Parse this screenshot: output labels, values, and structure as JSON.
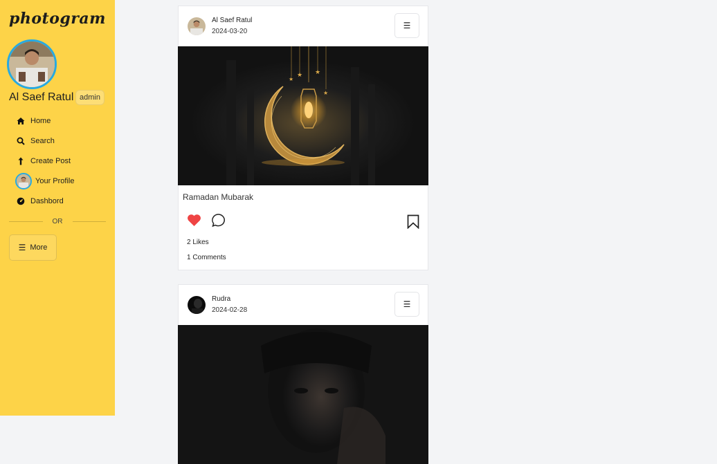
{
  "app": {
    "logo": "photogram"
  },
  "sidebar": {
    "user_name": "Al Saef Ratul",
    "role": "admin",
    "nav": [
      {
        "label": "Home",
        "icon": "home-icon"
      },
      {
        "label": "Search",
        "icon": "search-icon"
      },
      {
        "label": "Create Post",
        "icon": "arrow-up-icon"
      },
      {
        "label": "Your Profile",
        "icon": "avatar"
      },
      {
        "label": "Dashbord",
        "icon": "dashboard-icon"
      }
    ],
    "divider_text": "OR",
    "more_label": "More"
  },
  "posts": [
    {
      "author": "Al Saef Ratul",
      "date": "2024-03-20",
      "caption": "Ramadan Mubarak",
      "likes": "2 Likes",
      "comments": "1 Comments",
      "liked": true
    },
    {
      "author": "Rudra",
      "date": "2024-02-28"
    }
  ],
  "colors": {
    "sidebar_bg": "#fdd348",
    "accent_ring": "#27a9e1",
    "heart": "#ef4444",
    "page_bg": "#f3f4f6"
  }
}
